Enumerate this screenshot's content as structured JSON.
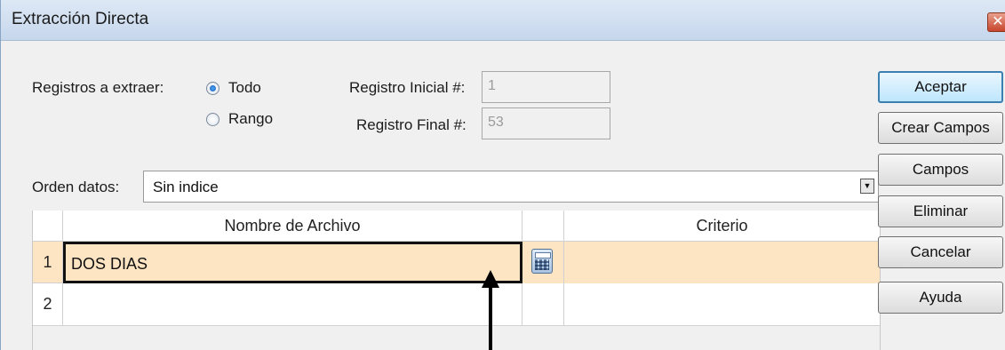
{
  "window": {
    "title": "Extracción Directa",
    "close_glyph": "✕"
  },
  "extract": {
    "label": "Registros a extraer:",
    "option_all": "Todo",
    "option_range": "Rango",
    "selected": "Todo",
    "initial_label": "Registro Inicial #:",
    "initial_value": "1",
    "final_label": "Registro Final #:",
    "final_value": "53"
  },
  "order": {
    "label": "Orden datos:",
    "value": "Sin indice"
  },
  "grid": {
    "headers": {
      "filename": "Nombre de Archivo",
      "criteria": "Criterio"
    },
    "rows": [
      {
        "num": "1",
        "filename": "DOS DIAS",
        "criteria": ""
      },
      {
        "num": "2",
        "filename": "",
        "criteria": ""
      }
    ]
  },
  "buttons": {
    "accept": "Aceptar",
    "create_fields": "Crear Campos",
    "fields": "Campos",
    "delete": "Eliminar",
    "cancel": "Cancelar",
    "help": "Ayuda"
  },
  "icons": {
    "close": "close-icon",
    "calculator": "calculator-icon",
    "dropdown": "chevron-down-icon"
  },
  "colors": {
    "selected_row": "#fde4c2",
    "default_button": "#3c7fb1",
    "titlebar": "#c6d7ec"
  }
}
